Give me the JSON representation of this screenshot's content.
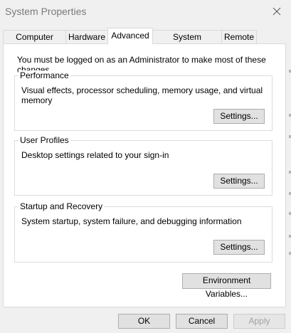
{
  "window": {
    "title": "System Properties"
  },
  "tabs": [
    {
      "label": "Computer Name",
      "active": false
    },
    {
      "label": "Hardware",
      "active": false
    },
    {
      "label": "Advanced",
      "active": true
    },
    {
      "label": "System Protection",
      "active": false
    },
    {
      "label": "Remote",
      "active": false
    }
  ],
  "advanced": {
    "admin_note": "You must be logged on as an Administrator to make most of these changes.",
    "performance": {
      "label": "Performance",
      "description": "Visual effects, processor scheduling, memory usage, and virtual memory",
      "button": "Settings..."
    },
    "user_profiles": {
      "label": "User Profiles",
      "description": "Desktop settings related to your sign-in",
      "button": "Settings..."
    },
    "startup_recovery": {
      "label": "Startup and Recovery",
      "description": "System startup, system failure, and debugging information",
      "button": "Settings..."
    },
    "env_button": "Environment Variables..."
  },
  "footer": {
    "ok": "OK",
    "cancel": "Cancel",
    "apply": "Apply"
  },
  "icons": {
    "close": "close-icon"
  },
  "colors": {
    "window_bg": "#f0f0f0",
    "panel_bg": "#ffffff",
    "button_bg": "#e1e1e1",
    "disabled_text": "#a0a0a0",
    "title_text": "#7a7a7a"
  }
}
